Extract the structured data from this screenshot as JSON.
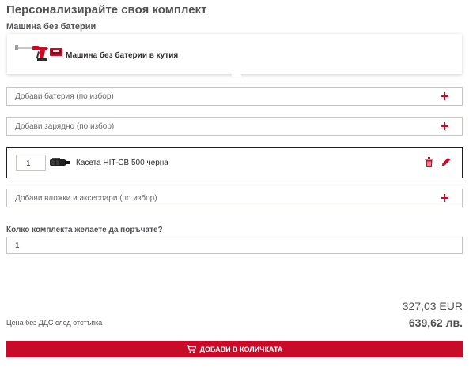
{
  "page": {
    "title": "Персонализирайте своя комплект",
    "machine_section_label": "Машина без батерии"
  },
  "machine": {
    "label": "Машина без батерии в кутия",
    "image_icon": "dispenser-gun-icon"
  },
  "options": {
    "battery": {
      "label": "Добави батерия (по избор)",
      "icon": "plus-icon"
    },
    "charger": {
      "label": "Добави зарядно (по избор)",
      "icon": "plus-icon"
    },
    "accessories": {
      "label": "Добави вложки и аксесоари (по избор)",
      "icon": "plus-icon"
    }
  },
  "selected_item": {
    "quantity": "1",
    "label": "Касета HIT-CB 500 черна",
    "image_icon": "cartridge-icon",
    "actions": [
      "trash-icon",
      "pencil-icon"
    ]
  },
  "quantity": {
    "question": "Колко комплекта желаете да поръчате?",
    "value": "1"
  },
  "price": {
    "eur": "327,03 EUR",
    "bgn": "639,62 лв.",
    "note": "Цена без ДДС след отстъпка"
  },
  "cart_button": {
    "label": "ДОБАВИ В КОЛИЧКАТА",
    "icon": "cart-icon"
  },
  "colors": {
    "accent": "#c80b28",
    "text": "#524f53",
    "border": "#c6c4c1"
  }
}
